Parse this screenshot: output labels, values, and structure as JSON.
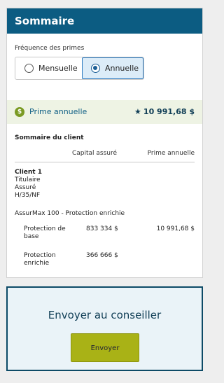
{
  "summary": {
    "title": "Sommaire",
    "frequency_label": "Fréquence des primes",
    "options": [
      {
        "label": "Mensuelle",
        "selected": false
      },
      {
        "label": "Annuelle",
        "selected": true
      }
    ],
    "prime_label": "Prime annuelle",
    "prime_value": "10 991,68 $",
    "client_summary_title": "Sommaire du client",
    "columns": {
      "capital": "Capital assuré",
      "prime": "Prime annuelle"
    },
    "client": {
      "name": "Client 1",
      "role": "Titulaire",
      "status": "Assuré",
      "code": "H/35/NF"
    },
    "product": "AssurMax 100 - Protection enrichie",
    "rows": [
      {
        "label": "Protection de base",
        "capital": "833 334 $",
        "prime": "10 991,68 $"
      },
      {
        "label": "Protection enrichie",
        "capital": "366 666 $",
        "prime": ""
      }
    ]
  },
  "send": {
    "title": "Envoyer au conseiller",
    "button_label": "Envoyer"
  },
  "colors": {
    "header": "#0c5c82",
    "accent": "#a9b216",
    "prime_bar": "#eef3e4"
  }
}
